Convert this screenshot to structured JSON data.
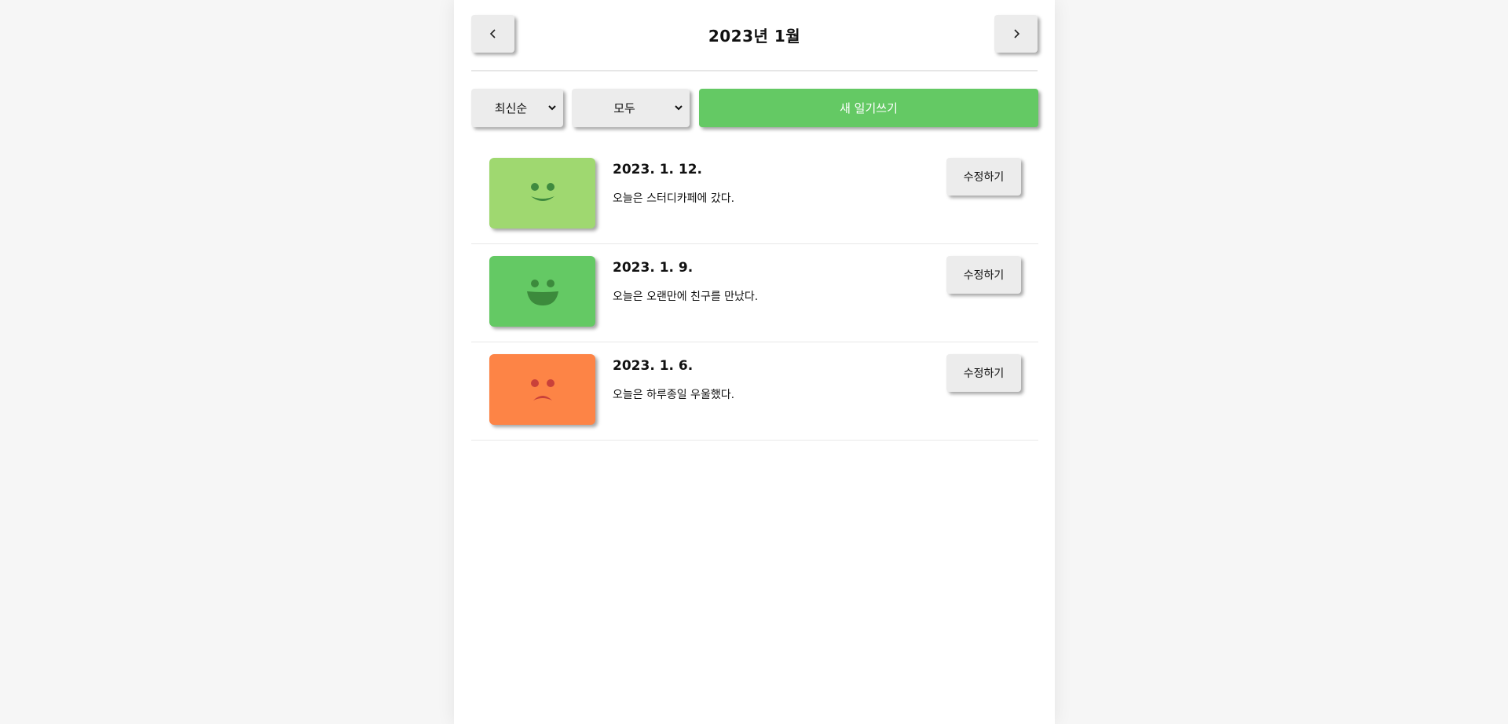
{
  "header": {
    "title": "2023년 1월",
    "prev_icon": "chevron-left-icon",
    "next_icon": "chevron-right-icon"
  },
  "controls": {
    "sort_value": "최신순",
    "filter_value": "모두",
    "new_label": "새 일기쓰기",
    "accent": "#64c964"
  },
  "entries": [
    {
      "date": "2023. 1. 12.",
      "content": "오늘은 스터디카페에 갔다.",
      "edit_label": "수정하기",
      "emotion": "good",
      "color": "#9fd870",
      "feature_color": "#3f8a3f"
    },
    {
      "date": "2023. 1. 9.",
      "content": "오늘은 오랜만에 친구를 만났다.",
      "edit_label": "수정하기",
      "emotion": "very-good",
      "color": "#64c964",
      "feature_color": "#3c8a3c"
    },
    {
      "date": "2023. 1. 6.",
      "content": "오늘은 하루종일 우울했다.",
      "edit_label": "수정하기",
      "emotion": "bad",
      "color": "#fd8446",
      "feature_color": "#c9413a"
    }
  ]
}
